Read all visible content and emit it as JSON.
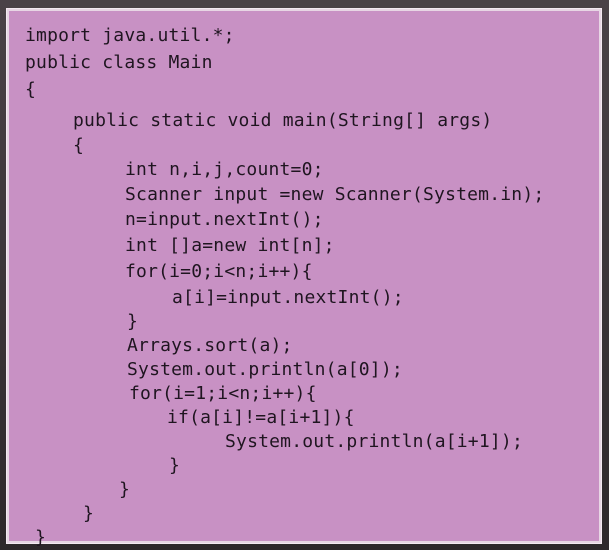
{
  "code": {
    "lines": [
      "import java.util.*;",
      "public class Main",
      "{",
      "public static void main(String[] args)",
      "{",
      "int n,i,j,count=0;",
      "Scanner input =new Scanner(System.in);",
      "n=input.nextInt();",
      "int []a=new int[n];",
      "for(i=0;i<n;i++){",
      "a[i]=input.nextInt();",
      "}",
      "Arrays.sort(a);",
      "System.out.println(a[0]);",
      "for(i=1;i<n;i++){",
      "if(a[i]!=a[i+1]){",
      "System.out.println(a[i+1]);",
      "}",
      "}",
      "}",
      "}"
    ]
  }
}
